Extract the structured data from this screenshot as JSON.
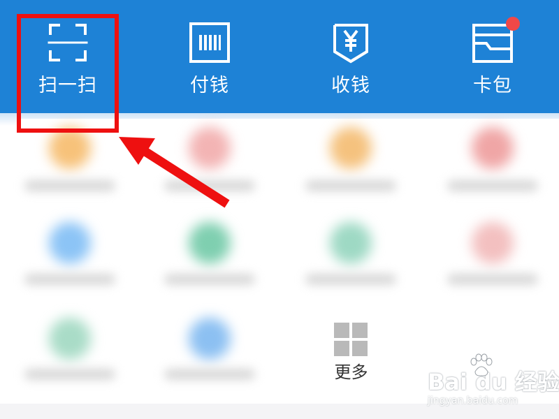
{
  "top_bar": {
    "background": "#1e82d6",
    "items": [
      {
        "label": "扫一扫",
        "icon": "scan-icon"
      },
      {
        "label": "付钱",
        "icon": "barcode-icon"
      },
      {
        "label": "收钱",
        "icon": "yuan-receive-icon"
      },
      {
        "label": "卡包",
        "icon": "card-wallet-icon",
        "has_notification": true
      }
    ]
  },
  "grid": {
    "more_label": "更多",
    "more_icon": "grid-more-icon",
    "blurred_icon_colors": [
      "#f7c27a",
      "#f3b4b4",
      "#f5c27e",
      "#f0a6a6",
      "#8cc4f6",
      "#7fcfb0",
      "#9ed9c4",
      "#f3c0c0",
      "#a9dcc7",
      "#8cc0f2"
    ]
  },
  "annotation": {
    "highlight_color": "#ee1010",
    "arrow_target": "扫一扫"
  },
  "watermark": {
    "main": "Bai du 经验",
    "sub": "jingyan.baidu.com"
  }
}
